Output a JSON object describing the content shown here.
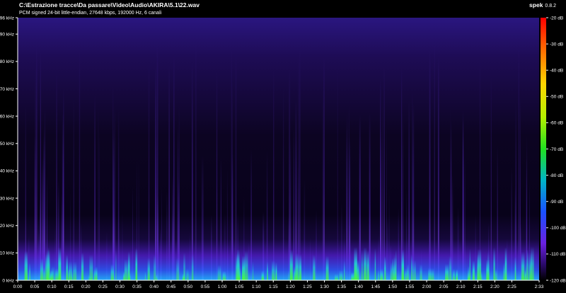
{
  "header": {
    "file_path": "C:\\Estrazione tracce\\Da passare\\Video\\Audio\\AKIRA\\5.1\\22.wav",
    "stream_info": "PCM signed 24-bit little-endian, 27648 kbps, 192000 Hz, 6 canali"
  },
  "brand": {
    "name": "spek",
    "version": "0.8.2"
  },
  "colors": {
    "background": "#000000",
    "spectrum_low": "#1a0a40",
    "spectrum_mid": "#5a1dd8",
    "spectrum_high": "#22e030",
    "scale_top": "#ff0000",
    "scale_bottom": "#000000"
  },
  "axes": {
    "frequency_labels": [
      "96 kHz",
      "90 kHz",
      "80 kHz",
      "70 kHz",
      "60 kHz",
      "50 kHz",
      "40 kHz",
      "30 kHz",
      "20 kHz",
      "10 kHz",
      "0 kHz"
    ],
    "frequency_values_khz": [
      96,
      90,
      80,
      70,
      60,
      50,
      40,
      30,
      20,
      10,
      0
    ],
    "time_labels": [
      "0:00",
      "0:05",
      "0:10",
      "0:15",
      "0:20",
      "0:25",
      "0:30",
      "0:35",
      "0:40",
      "0:45",
      "0:50",
      "0:55",
      "1:00",
      "1:05",
      "1:10",
      "1:15",
      "1:20",
      "1:25",
      "1:30",
      "1:35",
      "1:40",
      "1:45",
      "1:50",
      "1:55",
      "2:00",
      "2:05",
      "2:10",
      "2:15",
      "2:20",
      "2:25",
      "2:33"
    ],
    "time_values_s": [
      0,
      5,
      10,
      15,
      20,
      25,
      30,
      35,
      40,
      45,
      50,
      55,
      60,
      65,
      70,
      75,
      80,
      85,
      90,
      95,
      100,
      105,
      110,
      115,
      120,
      125,
      130,
      135,
      140,
      145,
      153
    ],
    "duration_s": 153,
    "max_khz": 96
  },
  "scale": {
    "db_labels": [
      "-20 dB",
      "-30 dB",
      "-40 dB",
      "-50 dB",
      "-60 dB",
      "-70 dB",
      "-80 dB",
      "-90 dB",
      "-100 dB",
      "-110 dB",
      "-120 dB"
    ],
    "db_values": [
      -20,
      -30,
      -40,
      -50,
      -60,
      -70,
      -80,
      -90,
      -100,
      -110,
      -120
    ]
  }
}
